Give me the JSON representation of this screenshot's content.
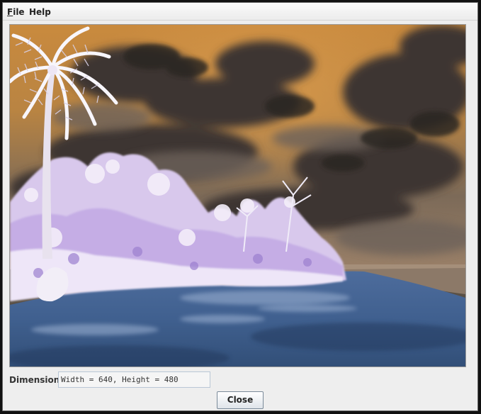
{
  "menubar": {
    "items": [
      {
        "mnemonic": "F",
        "rest": "ile"
      },
      {
        "mnemonic": "H",
        "rest": "elp"
      }
    ]
  },
  "dimension": {
    "label": "Dimension:",
    "value": "Width = 640, Height = 480"
  },
  "buttons": {
    "close": "Close"
  }
}
